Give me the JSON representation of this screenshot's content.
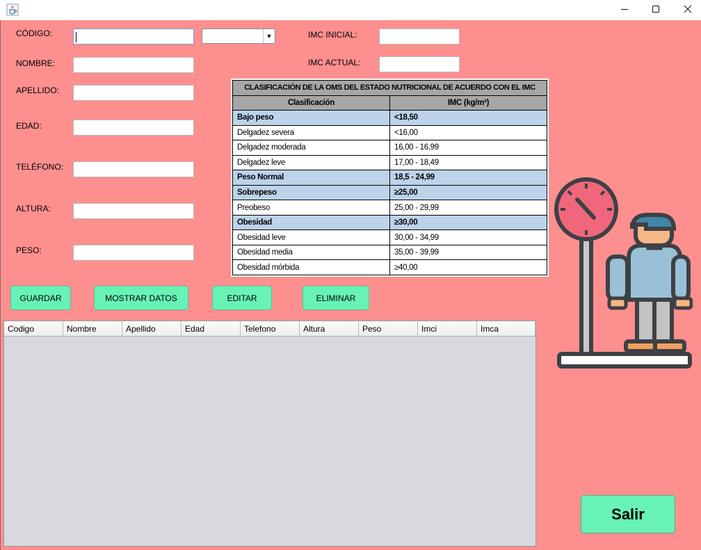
{
  "window": {
    "app_icon": "java-cup-icon",
    "controls": [
      "minimize-icon",
      "maximize-icon",
      "close-icon"
    ]
  },
  "form": {
    "codigo_label": "CÓDIGO:",
    "codigo_value": "",
    "codigo_combo_value": "",
    "nombre_label": "NOMBRE:",
    "nombre_value": "",
    "apellido_label": "APELLIDO:",
    "apellido_value": "",
    "edad_label": "EDAD:",
    "edad_value": "",
    "telefono_label": "TELÉFONO:",
    "telefono_value": "",
    "altura_label": "ALTURA:",
    "altura_value": "",
    "peso_label": "PESO:",
    "peso_value": "",
    "imc_inicial_label": "IMC INICIAL:",
    "imc_inicial_value": "",
    "imc_actual_label": "IMC ACTUAL:",
    "imc_actual_value": ""
  },
  "oms_table": {
    "title": "CLASIFICACIÓN DE LA OMS DEL ESTADO NUTRICIONAL DE ACUERDO CON EL IMC",
    "col1": "Clasificación",
    "col2": "IMC (kg/m²)",
    "rows": [
      {
        "clasificacion": "Bajo peso",
        "imc": "<18,50"
      },
      {
        "clasificacion": "Delgadez severa",
        "imc": "<16,00"
      },
      {
        "clasificacion": "Delgadez moderada",
        "imc": "16,00 - 16,99"
      },
      {
        "clasificacion": "Delgadez leve",
        "imc": "17,00 - 18,49"
      },
      {
        "clasificacion": "Peso Normal",
        "imc": "18,5 - 24,99"
      },
      {
        "clasificacion": "Sobrepeso",
        "imc": "≥25,00"
      },
      {
        "clasificacion": "Preobeso",
        "imc": "25,00 - 29,99"
      },
      {
        "clasificacion": "Obesidad",
        "imc": "≥30,00"
      },
      {
        "clasificacion": "Obesidad leve",
        "imc": "30,00 - 34,99"
      },
      {
        "clasificacion": "Obesidad media",
        "imc": "35,00 - 39,99"
      },
      {
        "clasificacion": "Obesidad mórbida",
        "imc": "≥40,00"
      }
    ]
  },
  "buttons": {
    "guardar": "GUARDAR",
    "mostrar": "MOSTRAR DATOS",
    "editar": "EDITAR",
    "eliminar": "ELIMINAR",
    "salir": "Salir"
  },
  "data_table": {
    "columns": [
      "Codigo",
      "Nombre",
      "Apellido",
      "Edad",
      "Telefono",
      "Altura",
      "Peso",
      "Imci",
      "Imca"
    ],
    "rows": []
  },
  "illustration": {
    "icon": "person-on-scale-icon",
    "colors": {
      "dial": "#f0677b",
      "shirt": "#9ac0d8",
      "pants": "#c3c3c3",
      "skin": "#f6b787",
      "hair": "#3f86a8",
      "outline": "#3e4045"
    }
  },
  "colors": {
    "background": "#fe8f8f",
    "button": "#68f2b6",
    "table_header": "#a6a6a6",
    "table_highlight": "#bcd3ea",
    "grid_background": "#d7d9df"
  }
}
